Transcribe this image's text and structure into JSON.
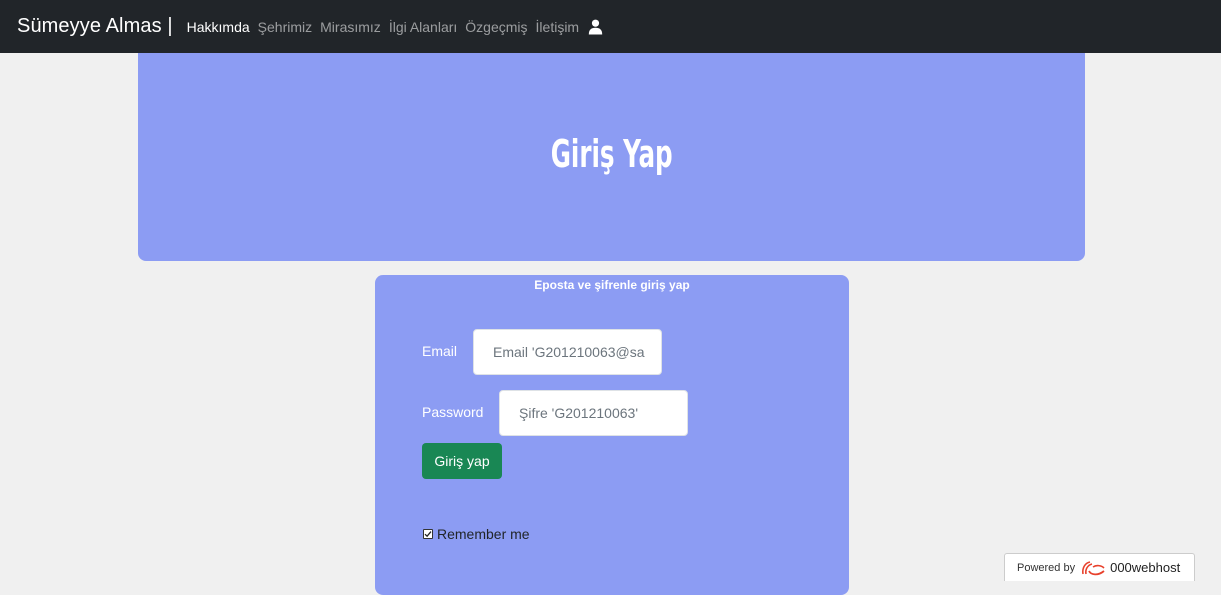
{
  "navbar": {
    "brand": "Sümeyye Almas |",
    "links": [
      {
        "label": "Hakkımda",
        "active": true
      },
      {
        "label": "Şehrimiz",
        "active": false
      },
      {
        "label": "Mirasımız",
        "active": false
      },
      {
        "label": "İlgi Alanları",
        "active": false
      },
      {
        "label": "Özgeçmiş",
        "active": false
      },
      {
        "label": "İletişim",
        "active": false
      }
    ],
    "user_icon": "user-icon"
  },
  "hero": {
    "title": "Giriş Yap",
    "color": "#8c9cf3"
  },
  "form": {
    "heading": "Eposta ve şifrenle giriş yap",
    "email_label": "Email",
    "email_placeholder": "Email 'G201210063@sa",
    "password_label": "Password",
    "password_placeholder": "Şifre 'G201210063'",
    "submit_label": "Giriş yap",
    "remember_label": "Remember me",
    "remember_checked": true,
    "submit_color": "#198754"
  },
  "footer_badge": {
    "prefix": "Powered by",
    "host": "000webhost"
  }
}
